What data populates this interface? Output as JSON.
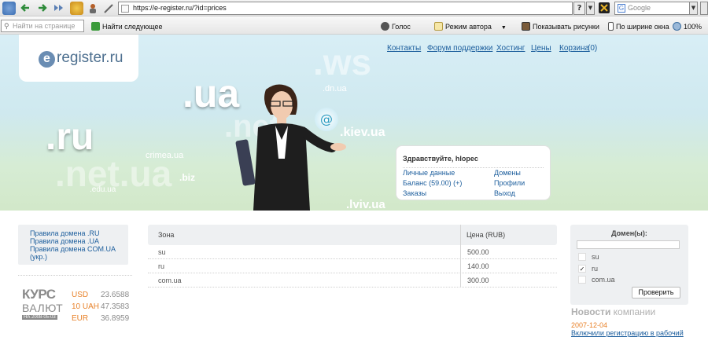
{
  "browser": {
    "url": "https://e-register.ru/?id=prices",
    "search_placeholder": "Google",
    "find_placeholder": "Найти на странице",
    "find_next": "Найти следующее",
    "voice": "Голос",
    "author_mode": "Режим автора",
    "show_images": "Показывать рисунки",
    "fit_width": "По ширине окна",
    "zoom": "100%"
  },
  "site": {
    "logo_letter": "e",
    "logo_text": "register.ru",
    "nav": [
      "Контакты",
      "Форум поддержки",
      "Хостинг",
      "Цены",
      "Корзина",
      "(0)"
    ]
  },
  "hero": {
    "tlds": [
      ".ua",
      ".ru",
      ".net.ua",
      ".dn.ua",
      ".kiev.ua",
      "crimea.ua",
      ".biz",
      ".edu.ua",
      ".lviv.ua",
      ".ws",
      ".net"
    ]
  },
  "welcome": {
    "greeting": "Здравствуйте, hlopec",
    "left_links": [
      "Личные данные",
      "Баланс (59.00) (+)",
      "Заказы"
    ],
    "right_links": [
      "Домены",
      "Профили",
      "Выход"
    ]
  },
  "rules": [
    "Правила домена .RU",
    "Правила домена .UA",
    "Правила домена COM.UA (укр.)"
  ],
  "kurs": {
    "title1": "КУРС",
    "title2": "ВАЛЮТ",
    "date": "НА 2008-05-03",
    "rates": [
      {
        "cur": "USD",
        "val": "23.6588"
      },
      {
        "cur": "10 UAH",
        "val": "47.3583"
      },
      {
        "cur": "EUR",
        "val": "36.8959"
      }
    ]
  },
  "prices": {
    "col_zone": "Зона",
    "col_price": "Цена (RUB)",
    "rows": [
      {
        "zone": "su",
        "price": "500.00"
      },
      {
        "zone": "ru",
        "price": "140.00"
      },
      {
        "zone": "com.ua",
        "price": "300.00"
      }
    ]
  },
  "domains_filter": {
    "title": "Домен(ы):",
    "options": [
      {
        "label": "su",
        "checked": false
      },
      {
        "label": "ru",
        "checked": true
      },
      {
        "label": "com.ua",
        "checked": false
      }
    ],
    "button": "Проверить"
  },
  "news": {
    "title_bold": "Новости",
    "title_rest": "компании",
    "date": "2007-12-04",
    "link": "Включили регистрацию в рабочий"
  },
  "colors": {
    "link": "#1b5d9c",
    "orange": "#e8822a",
    "logo": "#4d6f8f"
  }
}
